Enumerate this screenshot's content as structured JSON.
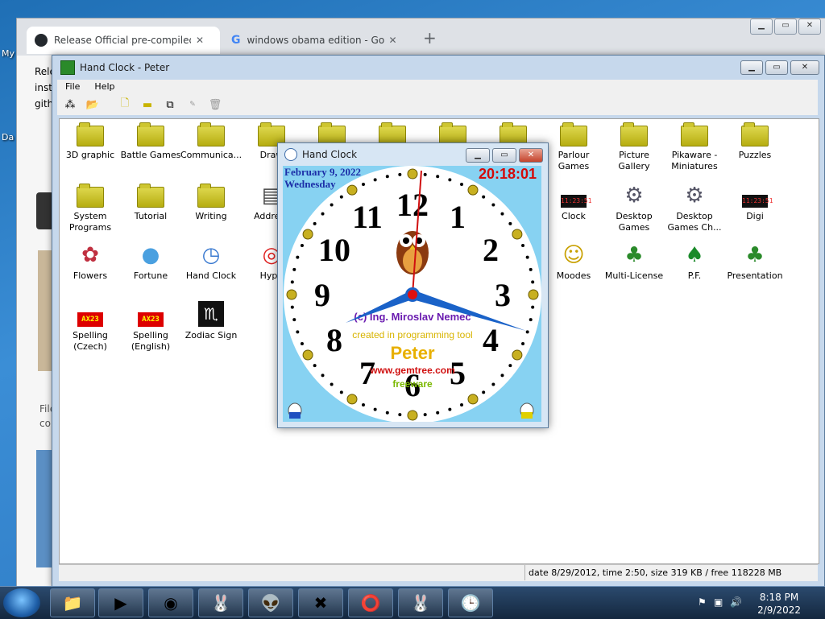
{
  "desktop": {
    "labels": [
      "My",
      "Da"
    ]
  },
  "chrome": {
    "tabs": [
      {
        "label": "Release Official pre-compiled ins",
        "icon": "github-icon",
        "active": true
      },
      {
        "label": "windows obama edition - Google",
        "icon": "google-icon",
        "active": false
      }
    ],
    "new_tab": "+",
    "page_snippets": [
      "Rele",
      "inst",
      "gith",
      "File",
      "con"
    ]
  },
  "peter": {
    "title": "Hand Clock - Peter",
    "menu": [
      "File",
      "Help"
    ],
    "items": [
      {
        "label": "3D graphic",
        "icon": "folder"
      },
      {
        "label": "Battle Games",
        "icon": "folder"
      },
      {
        "label": "Communica...",
        "icon": "folder"
      },
      {
        "label": "Draw",
        "icon": "folder"
      },
      {
        "label": "",
        "icon": "folder"
      },
      {
        "label": "",
        "icon": "folder"
      },
      {
        "label": "",
        "icon": "folder"
      },
      {
        "label": "",
        "icon": "folder"
      },
      {
        "label": "Parlour Games",
        "icon": "folder"
      },
      {
        "label": "Picture Gallery",
        "icon": "folder"
      },
      {
        "label": "Pikaware - Miniatures",
        "icon": "folder"
      },
      {
        "label": "Puzzles",
        "icon": "folder"
      },
      {
        "label": "System Programs",
        "icon": "folder"
      },
      {
        "label": "Tutorial",
        "icon": "folder"
      },
      {
        "label": "Writing",
        "icon": "folder"
      },
      {
        "label": "Address",
        "icon": "address"
      },
      {
        "label": "Clock",
        "icon": "digi"
      },
      {
        "label": "Desktop Games",
        "icon": "gear"
      },
      {
        "label": "Desktop Games Ch...",
        "icon": "gear"
      },
      {
        "label": "Digi",
        "icon": "digi"
      },
      {
        "label": "Flowers",
        "icon": "flower"
      },
      {
        "label": "Fortune",
        "icon": "ball"
      },
      {
        "label": "Hand Clock",
        "icon": "clock"
      },
      {
        "label": "Hypn",
        "icon": "hypno"
      },
      {
        "label": "Moodes",
        "icon": "smiley"
      },
      {
        "label": "Multi-License",
        "icon": "bunny"
      },
      {
        "label": "P.F.",
        "icon": "tree"
      },
      {
        "label": "Presentation",
        "icon": "bunny"
      },
      {
        "label": "Spelling (Czech)",
        "icon": "ax"
      },
      {
        "label": "Spelling (English)",
        "icon": "ax"
      },
      {
        "label": "Zodiac Sign",
        "icon": "zodiac"
      }
    ],
    "digi_text": "11:23:51",
    "ax_text": "AX23",
    "status": "date 8/29/2012, time 2:50, size 319 KB / free 118228 MB"
  },
  "handclock": {
    "title": "Hand Clock",
    "date": "February 9, 2022",
    "weekday": "Wednesday",
    "time": "20:18:01",
    "numbers": [
      "12",
      "1",
      "2",
      "3",
      "4",
      "5",
      "6",
      "7",
      "8",
      "9",
      "10",
      "11"
    ],
    "credit": "(c) Ing. Miroslav Nemec",
    "created": "created in programming tool",
    "peter": "Peter",
    "url": "www.gemtree.com",
    "freeware": "freeware"
  },
  "taskbar": {
    "time": "8:18 PM",
    "date": "2/9/2022"
  },
  "colors": {
    "clock_face": "#87d2f2",
    "date_text": "#1c2fa8",
    "time_text": "#d40a0a",
    "hand_blue": "#1a62c8",
    "folder": "#cbc21f"
  }
}
